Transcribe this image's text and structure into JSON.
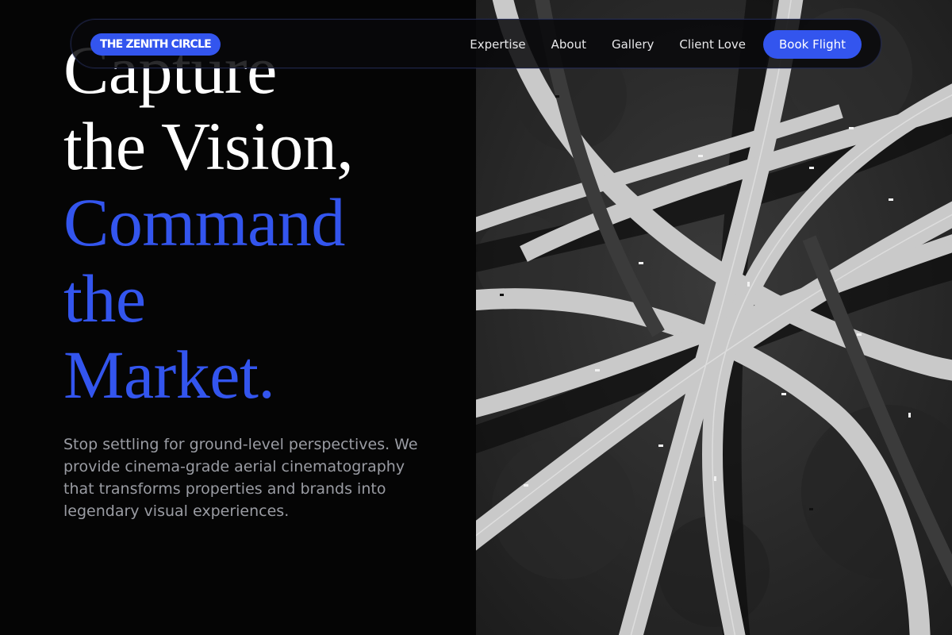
{
  "brand": {
    "logo_text": "THE ZENITH CIRCLE"
  },
  "nav": {
    "links": [
      "Expertise",
      "About",
      "Gallery",
      "Client Love"
    ],
    "cta_label": "Book Flight"
  },
  "hero": {
    "headline_lines": [
      "Capture",
      "the Vision,",
      "Command",
      "the",
      "Market."
    ],
    "subtitle": "Stop settling for ground-level perspectives. We provide cinema-grade aerial cinematography that transforms properties and brands into legendary visual experiences."
  },
  "colors": {
    "accent": "#3355ee",
    "background": "#050505",
    "text_primary": "#ffffff",
    "text_muted": "#9a9ca3"
  },
  "image": {
    "subject": "aerial-highway-interchange",
    "style": "black-and-white"
  }
}
